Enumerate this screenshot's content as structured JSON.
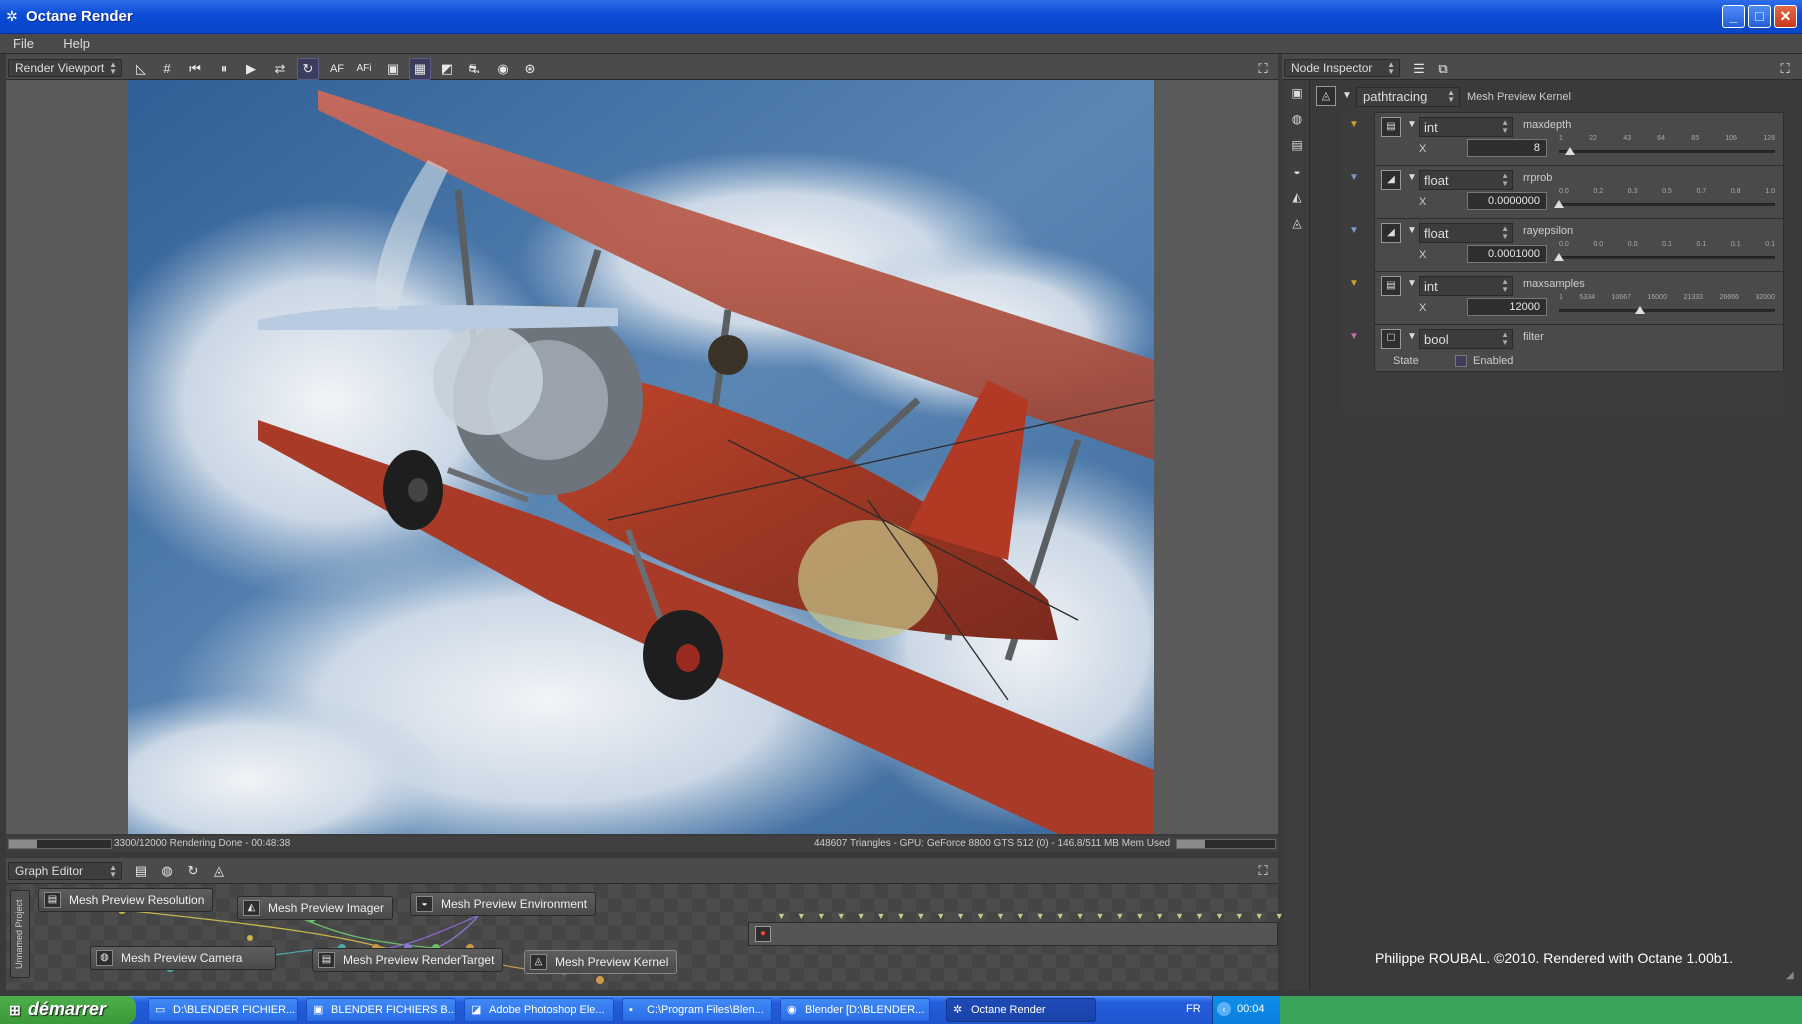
{
  "window": {
    "title": "Octane Render"
  },
  "menu": [
    "File",
    "Help"
  ],
  "viewport": {
    "panel_label": "Render Viewport",
    "status_left": "3300/12000 Rendering Done - 00:48:38",
    "status_right": "448607 Triangles - GPU: GeForce 8800 GTS 512 (0) - 146.8/511 MB Mem Used",
    "progress": 0.275
  },
  "graph": {
    "panel_label": "Graph Editor",
    "project_label": "Unnamed Project",
    "nodes": {
      "resolution": "Mesh Preview Resolution",
      "imager": "Mesh Preview Imager",
      "environment": "Mesh Preview Environment",
      "camera": "Mesh Preview Camera",
      "rendertarget": "Mesh Preview RenderTarget",
      "kernel": "Mesh Preview Kernel"
    }
  },
  "inspector": {
    "panel_label": "Node Inspector",
    "kernel_type": "pathtracing",
    "kernel_name": "Mesh Preview Kernel",
    "params": [
      {
        "type": "int",
        "name": "maxdepth",
        "axis": "X",
        "value": "8",
        "ticks": [
          "1",
          "22",
          "43",
          "64",
          "85",
          "106",
          "128"
        ],
        "pos": 0.05
      },
      {
        "type": "float",
        "name": "rrprob",
        "axis": "X",
        "value": "0.0000000",
        "ticks": [
          "0.0",
          "0.2",
          "0.3",
          "0.5",
          "0.7",
          "0.8",
          "1.0"
        ],
        "pos": 0.0
      },
      {
        "type": "float",
        "name": "rayepsilon",
        "axis": "X",
        "value": "0.0001000",
        "ticks": [
          "0.0",
          "0.0",
          "0.0",
          "0.1",
          "0.1",
          "0.1",
          "0.1"
        ],
        "pos": 0.0
      },
      {
        "type": "int",
        "name": "maxsamples",
        "axis": "X",
        "value": "12000",
        "ticks": [
          "1",
          "5334",
          "10667",
          "16000",
          "21333",
          "26666",
          "32000"
        ],
        "pos": 0.375
      },
      {
        "type": "bool",
        "name": "filter",
        "state_label": "State",
        "checkbox_label": "Enabled",
        "checked": false
      }
    ]
  },
  "credit": "Philippe ROUBAL. ©2010. Rendered with Octane 1.00b1.",
  "taskbar": {
    "start_label": "démarrer",
    "tasks": [
      "D:\\BLENDER FICHIER...",
      "BLENDER FICHIERS B...",
      "Adobe Photoshop Ele...",
      "C:\\Program Files\\Blen...",
      "Blender [D:\\BLENDER...",
      "Octane Render"
    ],
    "lang": "FR",
    "clock": "00:04"
  },
  "colors": {
    "titlebar": "#0a4bd6",
    "panel_bg": "#3a3a3a",
    "taskbar": "#245edb",
    "start": "#3a9a38",
    "plane_red": "#b23a25",
    "sky": "#3f6fa0"
  }
}
